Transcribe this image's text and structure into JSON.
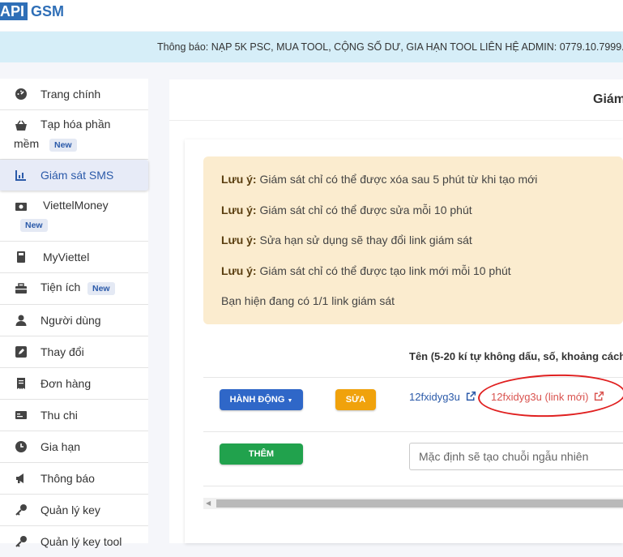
{
  "brand": {
    "api": "API",
    "gsm": "GSM",
    "accent": "#2f6fb7"
  },
  "notice": {
    "icon": "megaphone-icon",
    "text": "Thông báo: NẠP 5K PSC, MUA TOOL, CỘNG SỐ DƯ, GIA HẠN TOOL LIÊN HỆ ADMIN: 0779.10.7999."
  },
  "sidebar": {
    "items": [
      {
        "label": "Trang chính",
        "icon": "dashboard-icon"
      },
      {
        "label": "Tạp hóa phần",
        "label2": "mềm",
        "badge": "New",
        "icon": "basket-icon"
      },
      {
        "label": "Giám sát SMS",
        "icon": "chart-icon",
        "active": true
      },
      {
        "label": "ViettelMoney",
        "badge": "New",
        "icon": "money-icon"
      },
      {
        "label": "MyViettel",
        "icon": "calculator-icon"
      },
      {
        "label": "Tiện ích",
        "badge": "New",
        "icon": "toolbox-icon"
      },
      {
        "label": "Người dùng",
        "icon": "user-icon"
      },
      {
        "label": "Thay đổi",
        "icon": "edit-icon"
      },
      {
        "label": "Đơn hàng",
        "icon": "receipt-icon"
      },
      {
        "label": "Thu chi",
        "icon": "id-card-icon"
      },
      {
        "label": "Gia hạn",
        "icon": "clock-icon"
      },
      {
        "label": "Thông báo",
        "icon": "megaphone-icon"
      },
      {
        "label": "Quản lý key",
        "icon": "key-icon"
      },
      {
        "label": "Quản lý key tool",
        "icon": "key-icon"
      }
    ]
  },
  "main": {
    "title": "Giám",
    "alerts": [
      {
        "prefix": "Lưu ý:",
        "text": " Giám sát chỉ có thể được xóa sau 5 phút từ khi tạo mới"
      },
      {
        "prefix": "Lưu ý:",
        "text": " Giám sát chỉ có thể được sửa mỗi 10 phút"
      },
      {
        "prefix": "Lưu ý:",
        "text": " Sửa hạn sử dụng sẽ thay đổi link giám sát"
      },
      {
        "prefix": "Lưu ý:",
        "text": " Giám sát chỉ có thể được tạo link mới mỗi 10 phút"
      },
      {
        "prefix": "",
        "text": "Bạn hiện đang có 1/1 link giám sát"
      }
    ],
    "column_header": "Tên (5-20 kí tự không dấu, số, khoảng cách h",
    "row": {
      "action_button": "HÀNH ĐỘNG",
      "edit_button": "SỬA",
      "link_name": "12fxidyg3u",
      "new_link": "12fxidyg3u (link mới)"
    },
    "add_button": "THÊM",
    "input_placeholder": "Mặc định sẽ tạo chuỗi ngẫu nhiên"
  },
  "colors": {
    "blue": "#2f67c8",
    "orange": "#f0a20c",
    "green": "#21a24d",
    "alert_bg": "#fbeccf",
    "red_link": "#d9534f"
  }
}
